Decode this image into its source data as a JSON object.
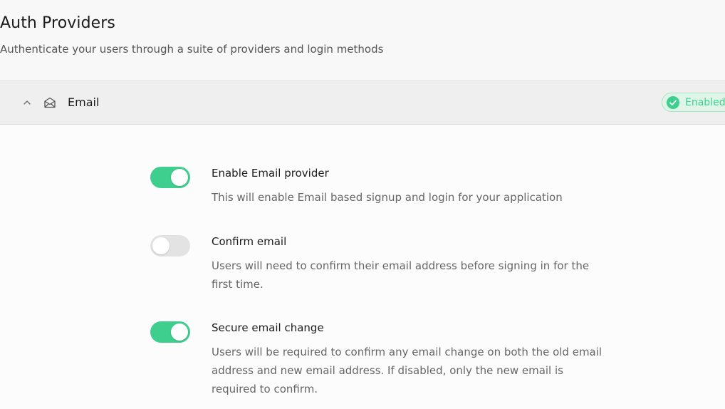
{
  "page": {
    "title": "Auth Providers",
    "subtitle": "Authenticate your users through a suite of providers and login methods"
  },
  "provider": {
    "name": "Email",
    "status": "Enabled",
    "expanded": true,
    "icons": {
      "chevron": "chevron-up-icon",
      "provider": "mail-icon",
      "status": "check-circle-icon"
    },
    "colors": {
      "accent": "#3ecf8e",
      "badge_bg": "#dff5e8",
      "toggle_off": "#e3e3e3"
    }
  },
  "settings": [
    {
      "label": "Enable Email provider",
      "description": "This will enable Email based signup and login for your application",
      "enabled": true
    },
    {
      "label": "Confirm email",
      "description": "Users will need to confirm their email address before signing in for the first time.",
      "enabled": false
    },
    {
      "label": "Secure email change",
      "description": "Users will be required to confirm any email change on both the old email address and new email address. If disabled, only the new email is required to confirm.",
      "enabled": true
    }
  ]
}
